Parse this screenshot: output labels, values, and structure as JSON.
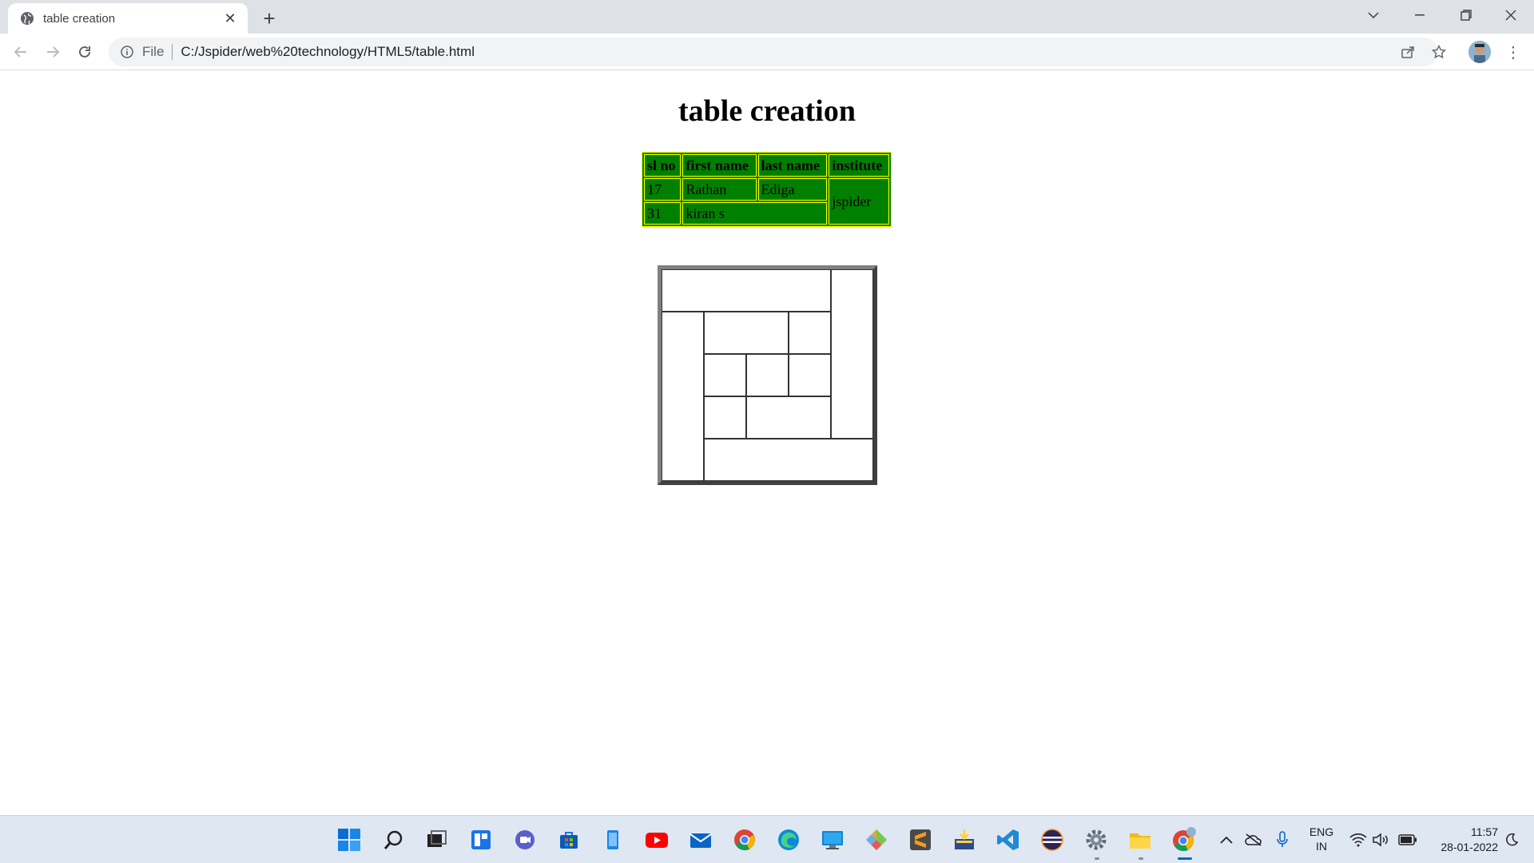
{
  "browser": {
    "tab_title": "table creation",
    "url_scheme": "File",
    "url": "C:/Jspider/web%20technology/HTML5/table.html",
    "icons": {
      "back": "back-arrow-icon",
      "forward": "forward-arrow-icon",
      "reload": "reload-icon",
      "info": "info-icon",
      "share": "share-icon",
      "bookmark": "star-icon",
      "menu": "kebab-menu-icon"
    }
  },
  "page": {
    "heading": "table creation",
    "students_table": {
      "headers": [
        "sl no",
        "first name",
        "last name",
        "institute"
      ],
      "rows": [
        {
          "sl_no": "17",
          "first_name": "Rathan",
          "last_name": "Ediga"
        },
        {
          "sl_no": "31",
          "full_name": "kiran s"
        }
      ],
      "institute": "jspider",
      "background_color": "#008000",
      "border_color": "#ffff00"
    }
  },
  "taskbar": {
    "apps": [
      "windows-start",
      "search",
      "task-view",
      "widgets",
      "teams-chat",
      "microsoft-store",
      "phone-link",
      "youtube",
      "mail",
      "chrome",
      "edge",
      "remote-desktop",
      "git",
      "sublime-text",
      "installer",
      "vscode",
      "eclipse",
      "settings",
      "file-explorer",
      "chrome-profile"
    ],
    "language_line1": "ENG",
    "language_line2": "IN",
    "time": "11:57",
    "date": "28-01-2022"
  }
}
